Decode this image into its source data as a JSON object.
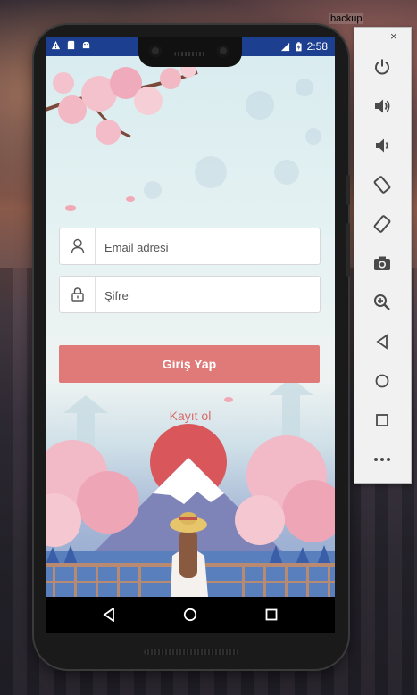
{
  "desktop": {
    "label": "backup"
  },
  "statusbar": {
    "time": "2:58",
    "left_icons": [
      "warning-icon",
      "sd-card-icon",
      "android-icon"
    ],
    "right_icons": [
      "signal-lte-icon",
      "battery-charging-icon"
    ]
  },
  "login": {
    "email_placeholder": "Email adresi",
    "password_placeholder": "Şifre",
    "login_button": "Giriş Yap",
    "register_link": "Kayıt ol"
  },
  "navbar": {
    "items": [
      "back-icon",
      "home-icon",
      "recents-icon"
    ]
  },
  "emulator": {
    "window_controls": [
      "minimize",
      "close"
    ],
    "minimize_glyph": "–",
    "close_glyph": "×",
    "buttons": [
      "power-icon",
      "volume-up-icon",
      "volume-down-icon",
      "rotate-left-icon",
      "rotate-right-icon",
      "camera-icon",
      "zoom-icon",
      "back-icon",
      "home-icon",
      "overview-icon",
      "more-icon"
    ]
  },
  "colors": {
    "accent": "#e07a78",
    "status_bar": "#1c3f8f",
    "register_text": "#d86a66"
  }
}
